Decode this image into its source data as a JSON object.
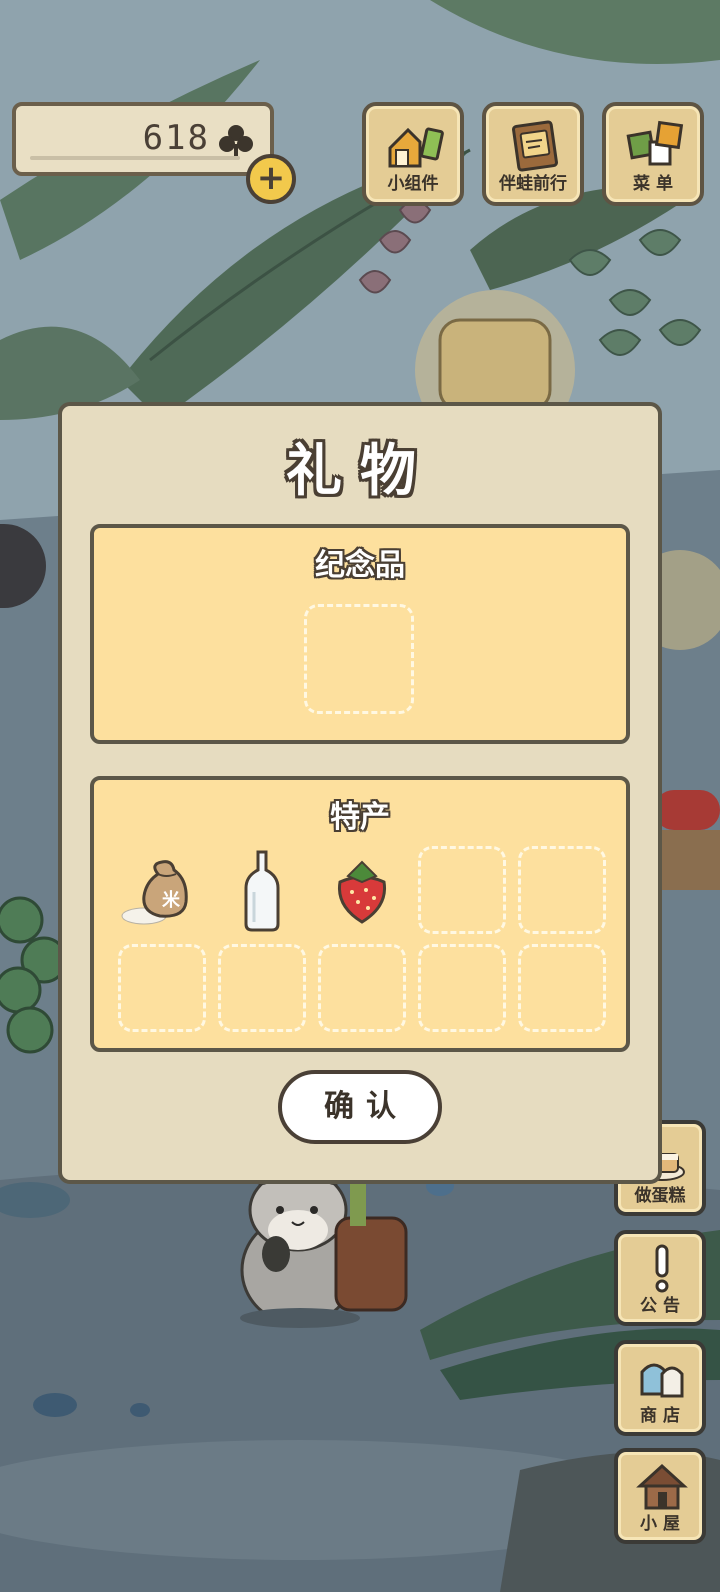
{
  "hud": {
    "clover_count": "618",
    "clover_icon": "clover-icon",
    "add_icon": "plus-icon"
  },
  "top_buttons": [
    {
      "label": "小组件",
      "icon": "widget-icon"
    },
    {
      "label": "伴蛙前行",
      "icon": "journal-icon"
    },
    {
      "label": "菜 单",
      "icon": "menu-cards-icon"
    }
  ],
  "side_buttons": [
    {
      "label": "做蛋糕",
      "icon": "cake-icon"
    },
    {
      "label": "公 告",
      "icon": "exclamation-icon"
    },
    {
      "label": "商 店",
      "icon": "shop-bags-icon"
    },
    {
      "label": "小 屋",
      "icon": "house-icon"
    }
  ],
  "dialog": {
    "title": "礼物",
    "souvenir": {
      "title": "纪念品",
      "slots": [
        {
          "item": null
        }
      ]
    },
    "specialty": {
      "title": "特产",
      "slots": [
        {
          "item": "rice-sack"
        },
        {
          "item": "glass-bottle"
        },
        {
          "item": "strawberry"
        },
        {
          "item": null
        },
        {
          "item": null
        },
        {
          "item": null
        },
        {
          "item": null
        },
        {
          "item": null
        },
        {
          "item": null
        },
        {
          "item": null
        }
      ]
    },
    "rice_sack_label": "米",
    "confirm_label": "确认"
  }
}
